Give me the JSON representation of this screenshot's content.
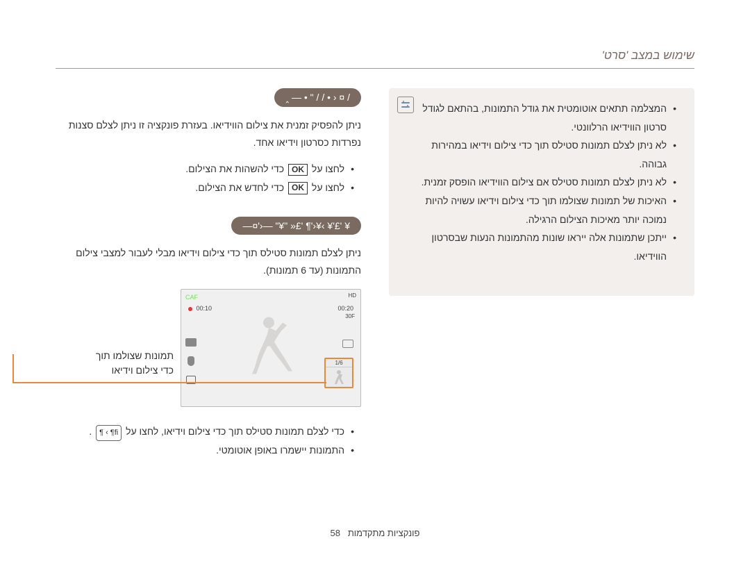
{
  "header": {
    "title": "שימוש במצב 'סרט'"
  },
  "section1": {
    "pill": "/ ¤ ‹ • / /   \" • — ‸",
    "para": "ניתן להפסיק זמנית את צילום הווידיאו. בעזרת פונקציה זו ניתן לצלם סצנות נפרדות כסרטון וידיאו אחד.",
    "bullets": {
      "b1_pre": "לחצו על ",
      "b1_ok": "OK",
      "b1_post": " כדי להשהות את הצילום.",
      "b2_pre": "לחצו על ",
      "b2_ok": "OK",
      "b2_post": " כדי לחדש את הצילום."
    }
  },
  "section2": {
    "pill": "¥   '£'¥   ›¥‹'¶  '£«  \"¥\"  —‹'¤—",
    "para": "ניתן לצלם תמונות סטילס תוך כדי צילום וידיאו מבלי לעבור למצבי צילום התמונות (עד 6 תמונות).",
    "callout_line1": "תמונות שצולמו תוך",
    "callout_line2": "כדי צילום וידיאו",
    "bullets": {
      "b1_pre": "כדי לצלם תמונות סטילס תוך כדי צילום וידיאו, לחצו על",
      "b1_btn": "fi¶ › ¶",
      "b1_post": ".",
      "b2": "התמונות יישמרו באופן אוטומטי."
    }
  },
  "viewfinder": {
    "caf": "CAF",
    "hd": "HD",
    "rec_time": "00:10",
    "total_time": "00:20",
    "fps": "30F",
    "thumb_count": "1/6"
  },
  "notes": {
    "n1": "המצלמה תתאים אוטומטית את גודל התמונות, בהתאם לגודל סרטון הווידיאו הרלוונטי.",
    "n2": "לא ניתן לצלם תמונות סטילס תוך כדי צילום וידיאו במהירות גבוהה.",
    "n3": "לא ניתן לצלם תמונות סטילס אם צילום הווידיאו הופסק זמנית.",
    "n4": "האיכות של תמונות שצולמו תוך כדי צילום וידיאו עשויה להיות נמוכה יותר מאיכות הצילום הרגילה.",
    "n5": "ייתכן שתמונות אלה ייראו שונות מהתמונות הנעות שבסרטון הווידיאו."
  },
  "footer": {
    "text": "פונקציות מתקדמות",
    "page": "58"
  }
}
